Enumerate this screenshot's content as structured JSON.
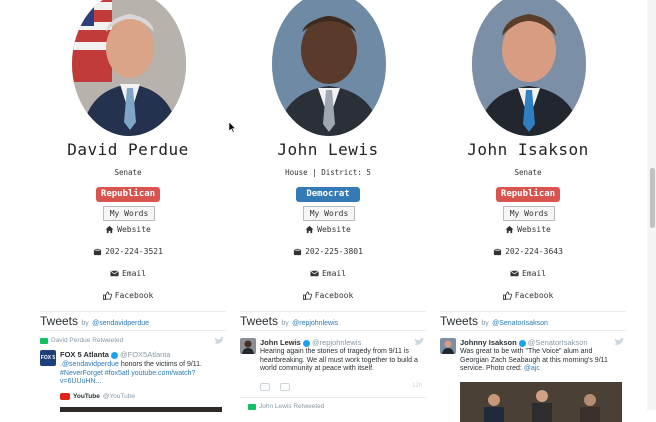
{
  "colors": {
    "republican": "#d9534f",
    "democrat": "#337ab7",
    "link": "#2b7bb9",
    "muted": "#8899a6"
  },
  "common": {
    "my_words": "My Words",
    "website": "Website",
    "email": "Email",
    "facebook": "Facebook",
    "tweets_title": "Tweets",
    "tweets_by": "by",
    "icons": [
      "home-icon",
      "phone-icon",
      "envelope-icon",
      "thumbs-up-icon",
      "twitter-bird-icon",
      "retweet-icon",
      "verified-icon"
    ]
  },
  "legislators": [
    {
      "name": "David Perdue",
      "office": "Senate",
      "party": "Republican",
      "phone": "202-224-3521",
      "twitter_handle": "@sendavidperdue",
      "timeline": {
        "retweet_label": "David Perdue Retweeted",
        "author": "FOX 5 Atlanta",
        "handle": "@FOX5Atlanta",
        "avatar_text": "FOX 5",
        "text_link": ".@sendavidperdue",
        "text": " honors the victims of 9/11.",
        "text_tags": "#NeverForget #fox5atl youtube.com/watch?v=6UUuHN...",
        "media_source": "YouTube",
        "media_handle": "@YouTube"
      }
    },
    {
      "name": "John Lewis",
      "office": "House | District: 5",
      "party": "Democrat",
      "phone": "202-225-3801",
      "twitter_handle": "@repjohnlewis",
      "timeline": {
        "author": "John Lewis",
        "handle": "@repjohnlewis",
        "text": "Hearing again the stories of tragedy from 9/11 is heartbreaking. We all must work together to build a world community at peace with itself.",
        "time": "12h",
        "retweet_label": "John Lewis Retweeted"
      }
    },
    {
      "name": "John Isakson",
      "office": "Senate",
      "party": "Republican",
      "phone": "202-224-3643",
      "twitter_handle": "@SenatorIsakson",
      "timeline": {
        "author": "Johnny Isakson",
        "handle": "@SenatorIsakson",
        "text": "Was great to be with \"The Voice\" alum and Georgian Zach Seabaugh at this morning's 9/11 service. Photo cred: ",
        "text_link": "@ajc"
      }
    }
  ]
}
